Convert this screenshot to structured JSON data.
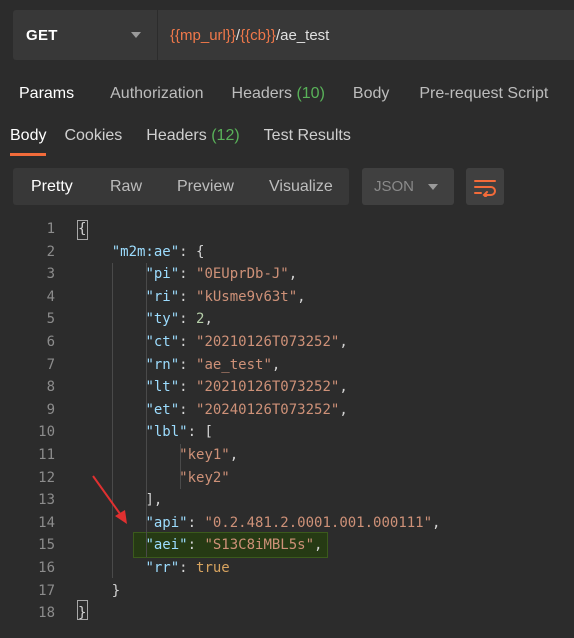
{
  "request": {
    "method": "GET",
    "url_parts": [
      {
        "text": "{{mp_url}}",
        "type": "var"
      },
      {
        "text": "/",
        "type": "plain"
      },
      {
        "text": "{{cb}}",
        "type": "var"
      },
      {
        "text": "/ae_test",
        "type": "plain"
      }
    ]
  },
  "request_tabs": [
    {
      "label": "Params",
      "count": ""
    },
    {
      "label": "Authorization",
      "count": ""
    },
    {
      "label": "Headers",
      "count": "(10)"
    },
    {
      "label": "Body",
      "count": ""
    },
    {
      "label": "Pre-request Script",
      "count": ""
    }
  ],
  "response_tabs": [
    {
      "label": "Body",
      "count": ""
    },
    {
      "label": "Cookies",
      "count": ""
    },
    {
      "label": "Headers",
      "count": "(12)"
    },
    {
      "label": "Test Results",
      "count": ""
    }
  ],
  "view_modes": [
    "Pretty",
    "Raw",
    "Preview",
    "Visualize"
  ],
  "format": "JSON",
  "code_lines": [
    {
      "n": "1",
      "parts": [
        {
          "t": "{",
          "c": "pun"
        }
      ]
    },
    {
      "n": "2",
      "parts": [
        {
          "t": "    ",
          "c": "pun"
        },
        {
          "t": "\"m2m:ae\"",
          "c": "key"
        },
        {
          "t": ": {",
          "c": "pun"
        }
      ]
    },
    {
      "n": "3",
      "parts": [
        {
          "t": "        ",
          "c": "pun"
        },
        {
          "t": "\"pi\"",
          "c": "key"
        },
        {
          "t": ": ",
          "c": "pun"
        },
        {
          "t": "\"0EUprDb-J\"",
          "c": "str"
        },
        {
          "t": ",",
          "c": "pun"
        }
      ]
    },
    {
      "n": "4",
      "parts": [
        {
          "t": "        ",
          "c": "pun"
        },
        {
          "t": "\"ri\"",
          "c": "key"
        },
        {
          "t": ": ",
          "c": "pun"
        },
        {
          "t": "\"kUsme9v63t\"",
          "c": "str"
        },
        {
          "t": ",",
          "c": "pun"
        }
      ]
    },
    {
      "n": "5",
      "parts": [
        {
          "t": "        ",
          "c": "pun"
        },
        {
          "t": "\"ty\"",
          "c": "key"
        },
        {
          "t": ": ",
          "c": "pun"
        },
        {
          "t": "2",
          "c": "num"
        },
        {
          "t": ",",
          "c": "pun"
        }
      ]
    },
    {
      "n": "6",
      "parts": [
        {
          "t": "        ",
          "c": "pun"
        },
        {
          "t": "\"ct\"",
          "c": "key"
        },
        {
          "t": ": ",
          "c": "pun"
        },
        {
          "t": "\"20210126T073252\"",
          "c": "str"
        },
        {
          "t": ",",
          "c": "pun"
        }
      ]
    },
    {
      "n": "7",
      "parts": [
        {
          "t": "        ",
          "c": "pun"
        },
        {
          "t": "\"rn\"",
          "c": "key"
        },
        {
          "t": ": ",
          "c": "pun"
        },
        {
          "t": "\"ae_test\"",
          "c": "str"
        },
        {
          "t": ",",
          "c": "pun"
        }
      ]
    },
    {
      "n": "8",
      "parts": [
        {
          "t": "        ",
          "c": "pun"
        },
        {
          "t": "\"lt\"",
          "c": "key"
        },
        {
          "t": ": ",
          "c": "pun"
        },
        {
          "t": "\"20210126T073252\"",
          "c": "str"
        },
        {
          "t": ",",
          "c": "pun"
        }
      ]
    },
    {
      "n": "9",
      "parts": [
        {
          "t": "        ",
          "c": "pun"
        },
        {
          "t": "\"et\"",
          "c": "key"
        },
        {
          "t": ": ",
          "c": "pun"
        },
        {
          "t": "\"20240126T073252\"",
          "c": "str"
        },
        {
          "t": ",",
          "c": "pun"
        }
      ]
    },
    {
      "n": "10",
      "parts": [
        {
          "t": "        ",
          "c": "pun"
        },
        {
          "t": "\"lbl\"",
          "c": "key"
        },
        {
          "t": ": [",
          "c": "pun"
        }
      ]
    },
    {
      "n": "11",
      "parts": [
        {
          "t": "            ",
          "c": "pun"
        },
        {
          "t": "\"key1\"",
          "c": "str"
        },
        {
          "t": ",",
          "c": "pun"
        }
      ]
    },
    {
      "n": "12",
      "parts": [
        {
          "t": "            ",
          "c": "pun"
        },
        {
          "t": "\"key2\"",
          "c": "str"
        }
      ]
    },
    {
      "n": "13",
      "parts": [
        {
          "t": "        ",
          "c": "pun"
        },
        {
          "t": "],",
          "c": "pun"
        }
      ]
    },
    {
      "n": "14",
      "parts": [
        {
          "t": "        ",
          "c": "pun"
        },
        {
          "t": "\"api\"",
          "c": "key"
        },
        {
          "t": ": ",
          "c": "pun"
        },
        {
          "t": "\"0.2.481.2.0001.001.000111\"",
          "c": "str"
        },
        {
          "t": ",",
          "c": "pun"
        }
      ]
    },
    {
      "n": "15",
      "parts": [
        {
          "t": "        ",
          "c": "pun"
        },
        {
          "t": "\"aei\"",
          "c": "key"
        },
        {
          "t": ": ",
          "c": "pun"
        },
        {
          "t": "\"S13C8iMBL5s\"",
          "c": "str"
        },
        {
          "t": ",",
          "c": "pun"
        }
      ]
    },
    {
      "n": "16",
      "parts": [
        {
          "t": "        ",
          "c": "pun"
        },
        {
          "t": "\"rr\"",
          "c": "key"
        },
        {
          "t": ": ",
          "c": "pun"
        },
        {
          "t": "true",
          "c": "bool"
        }
      ]
    },
    {
      "n": "17",
      "parts": [
        {
          "t": "    ",
          "c": "pun"
        },
        {
          "t": "}",
          "c": "pun"
        }
      ]
    },
    {
      "n": "18",
      "parts": [
        {
          "t": "}",
          "c": "pun"
        }
      ]
    }
  ],
  "annotation": {
    "arrow_color": "#e03030",
    "highlight_line": "15"
  },
  "colors": {
    "accent": "#f26b3a",
    "count": "#59b259",
    "variable": "#f0784a"
  },
  "icons": {
    "method_dropdown": "caret-down-icon",
    "format_dropdown": "caret-down-icon",
    "wrap": "wrap-lines-icon"
  }
}
